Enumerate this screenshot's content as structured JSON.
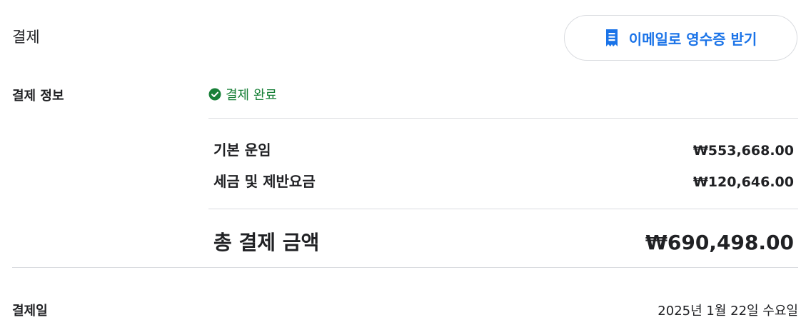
{
  "header": {
    "title": "결제",
    "receipt_button_label": "이메일로 영수증 받기",
    "receipt_icon": "receipt-icon"
  },
  "payment_info": {
    "label": "결제 정보",
    "status_icon": "check-circle-icon",
    "status_text": "결제 완료"
  },
  "charges": [
    {
      "label": "기본 운임",
      "amount": "₩553,668.00"
    },
    {
      "label": "세금 및 제반요금",
      "amount": "₩120,646.00"
    }
  ],
  "total": {
    "label": "총 결제 금액",
    "amount": "₩690,498.00"
  },
  "payment_date": {
    "label": "결제일",
    "value": "2025년 1월 22일 수요일"
  },
  "colors": {
    "accent": "#1a73e8",
    "success": "#188038",
    "divider": "#dadce0",
    "text": "#202124"
  }
}
